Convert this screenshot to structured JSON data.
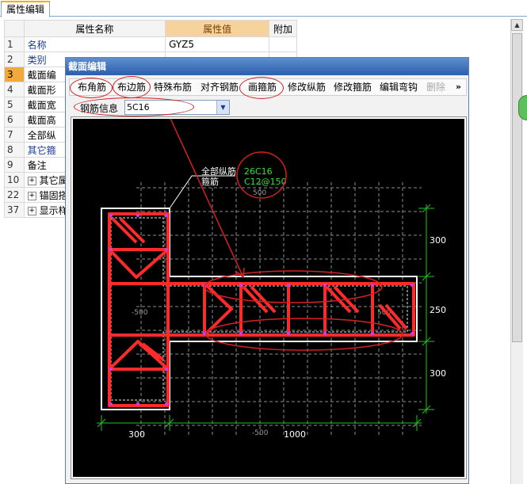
{
  "top_tab": {
    "label": "属性编辑"
  },
  "prop_table": {
    "headers": {
      "name": "属性名称",
      "value": "属性值",
      "extra": "附加"
    },
    "rows": [
      {
        "num": "1",
        "name": "名称",
        "value": "GYZ5",
        "blue": true,
        "expand": false
      },
      {
        "num": "2",
        "name": "类别",
        "value": "",
        "blue": true,
        "expand": false
      },
      {
        "num": "3",
        "name": "截面编",
        "value": "",
        "blue": false,
        "expand": false
      },
      {
        "num": "4",
        "name": "截面形",
        "value": "",
        "blue": false,
        "expand": false
      },
      {
        "num": "5",
        "name": "截面宽",
        "value": "",
        "blue": false,
        "expand": false
      },
      {
        "num": "6",
        "name": "截面高",
        "value": "",
        "blue": false,
        "expand": false
      },
      {
        "num": "7",
        "name": "全部纵",
        "value": "",
        "blue": false,
        "expand": false
      },
      {
        "num": "8",
        "name": "其它箍",
        "value": "",
        "blue": true,
        "expand": false
      },
      {
        "num": "9",
        "name": "备注",
        "value": "",
        "blue": false,
        "expand": false
      },
      {
        "num": "10",
        "name": "其它属",
        "value": "",
        "blue": false,
        "expand": true
      },
      {
        "num": "22",
        "name": "锚固搭",
        "value": "",
        "blue": false,
        "expand": true
      },
      {
        "num": "37",
        "name": "显示样",
        "value": "",
        "blue": false,
        "expand": true
      }
    ]
  },
  "dialog": {
    "title": "截面编辑",
    "toolbar": [
      "布角筋",
      "布边筋",
      "特殊布筋",
      "对齐钢筋",
      "画箍筋",
      "修改纵筋",
      "修改箍筋",
      "编辑弯钩",
      "删除"
    ],
    "toolbar_more": "»",
    "rebar_label": "钢筋信息",
    "rebar_value": "5C16"
  },
  "drawing": {
    "leader_label_1": "全部纵筋",
    "leader_label_2": "箍筋",
    "leader_value_1": "26C16",
    "leader_value_2": "C12@150",
    "dims_right": [
      "300",
      "250",
      "300"
    ],
    "dims_bottom": [
      "300",
      "1000"
    ],
    "grid_labels": [
      "500",
      "-500",
      "500",
      "-500"
    ]
  },
  "colors": {
    "rebar": "#ff2a2a",
    "dim": "#1fc21f",
    "outline": "#ffffff",
    "grid": "#8c8c8c",
    "annotation": "#d42020"
  }
}
